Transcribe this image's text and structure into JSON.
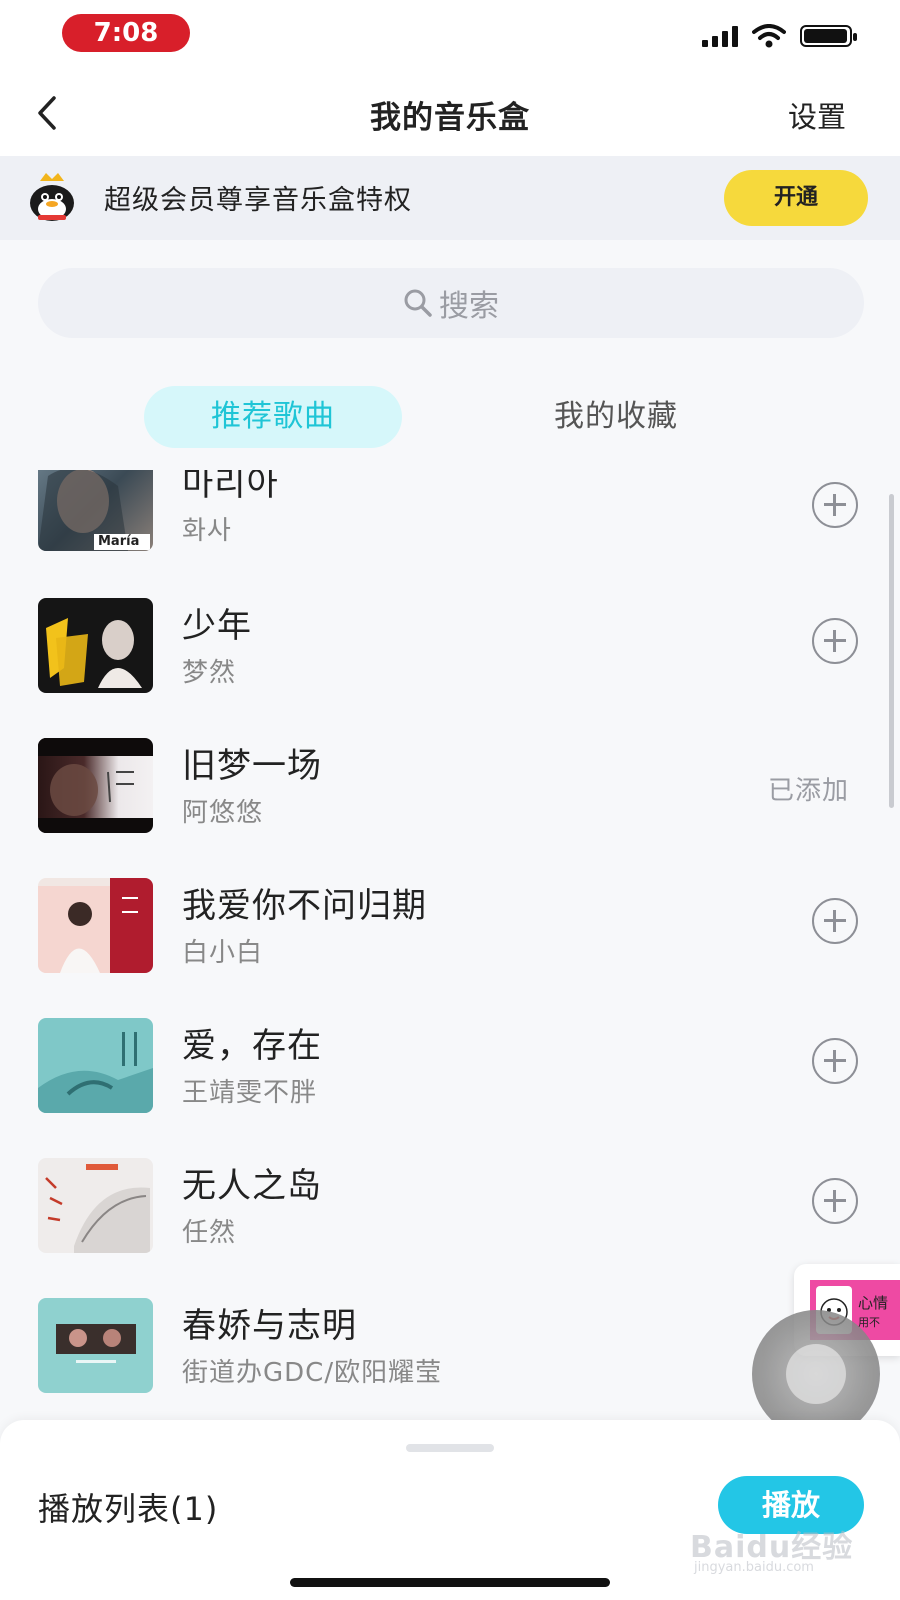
{
  "status_bar": {
    "time": "7:08",
    "icons": [
      "signal-icon",
      "wifi-icon",
      "battery-icon"
    ]
  },
  "nav": {
    "title": "我的音乐盒",
    "settings_label": "设置",
    "back_icon": "chevron-left-icon"
  },
  "vip_banner": {
    "text": "超级会员尊享音乐盒特权",
    "button_label": "开通",
    "accent": "#f6d93c"
  },
  "search": {
    "placeholder": "搜索"
  },
  "tabs": [
    {
      "label": "推荐歌曲",
      "active": true
    },
    {
      "label": "我的收藏",
      "active": false
    }
  ],
  "songs": [
    {
      "title": "마리아",
      "artist": "화사",
      "cover_text": "María",
      "added": false
    },
    {
      "title": "少年",
      "artist": "梦然",
      "added": false
    },
    {
      "title": "旧梦一场",
      "artist": "阿悠悠",
      "added": true,
      "added_label": "已添加"
    },
    {
      "title": "我爱你不问归期",
      "artist": "白小白",
      "added": false
    },
    {
      "title": "爱，存在",
      "artist": "王靖雯不胖",
      "added": false
    },
    {
      "title": "无人之岛",
      "artist": "任然",
      "added": false
    },
    {
      "title": "春娇与志明",
      "artist": "街道办GDC/欧阳耀莹",
      "added": false
    }
  ],
  "float_ad": {
    "title": "心情",
    "subtitle": "用不"
  },
  "bottom_sheet": {
    "playlist_label": "播放列表(1)",
    "play_label": "播放",
    "play_color": "#23c6e6"
  },
  "watermark": {
    "main": "Baidu经验",
    "sub": "jingyan.baidu.com"
  },
  "colors": {
    "tab_active_bg": "#d6f7fa",
    "tab_active_text": "#1fc5d6",
    "status_time_bg": "#d81f2a"
  }
}
